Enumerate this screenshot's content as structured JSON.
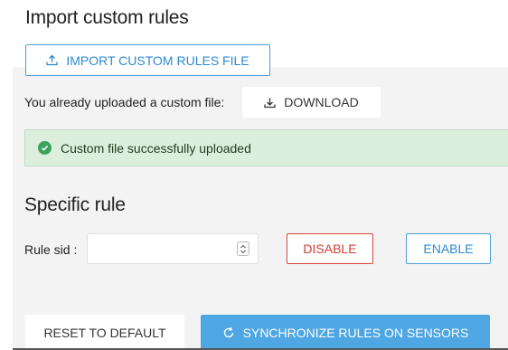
{
  "import_section": {
    "title": "Import custom rules",
    "import_button": "IMPORT CUSTOM RULES FILE",
    "uploaded_text": "You already uploaded a custom file:",
    "download_button": "DOWNLOAD",
    "success_message": "Custom file successfully uploaded"
  },
  "specific_rule": {
    "title": "Specific rule",
    "sid_label": "Rule sid :",
    "sid_value": "",
    "disable_button": "DISABLE",
    "enable_button": "ENABLE"
  },
  "actions": {
    "reset_button": "RESET TO DEFAULT",
    "sync_button": "SYNCHRONIZE RULES ON SENSORS"
  },
  "colors": {
    "accent": "#4ea6e3",
    "danger": "#d33b32",
    "success_bg": "#dcefdc",
    "success_icon": "#3aa35c"
  }
}
